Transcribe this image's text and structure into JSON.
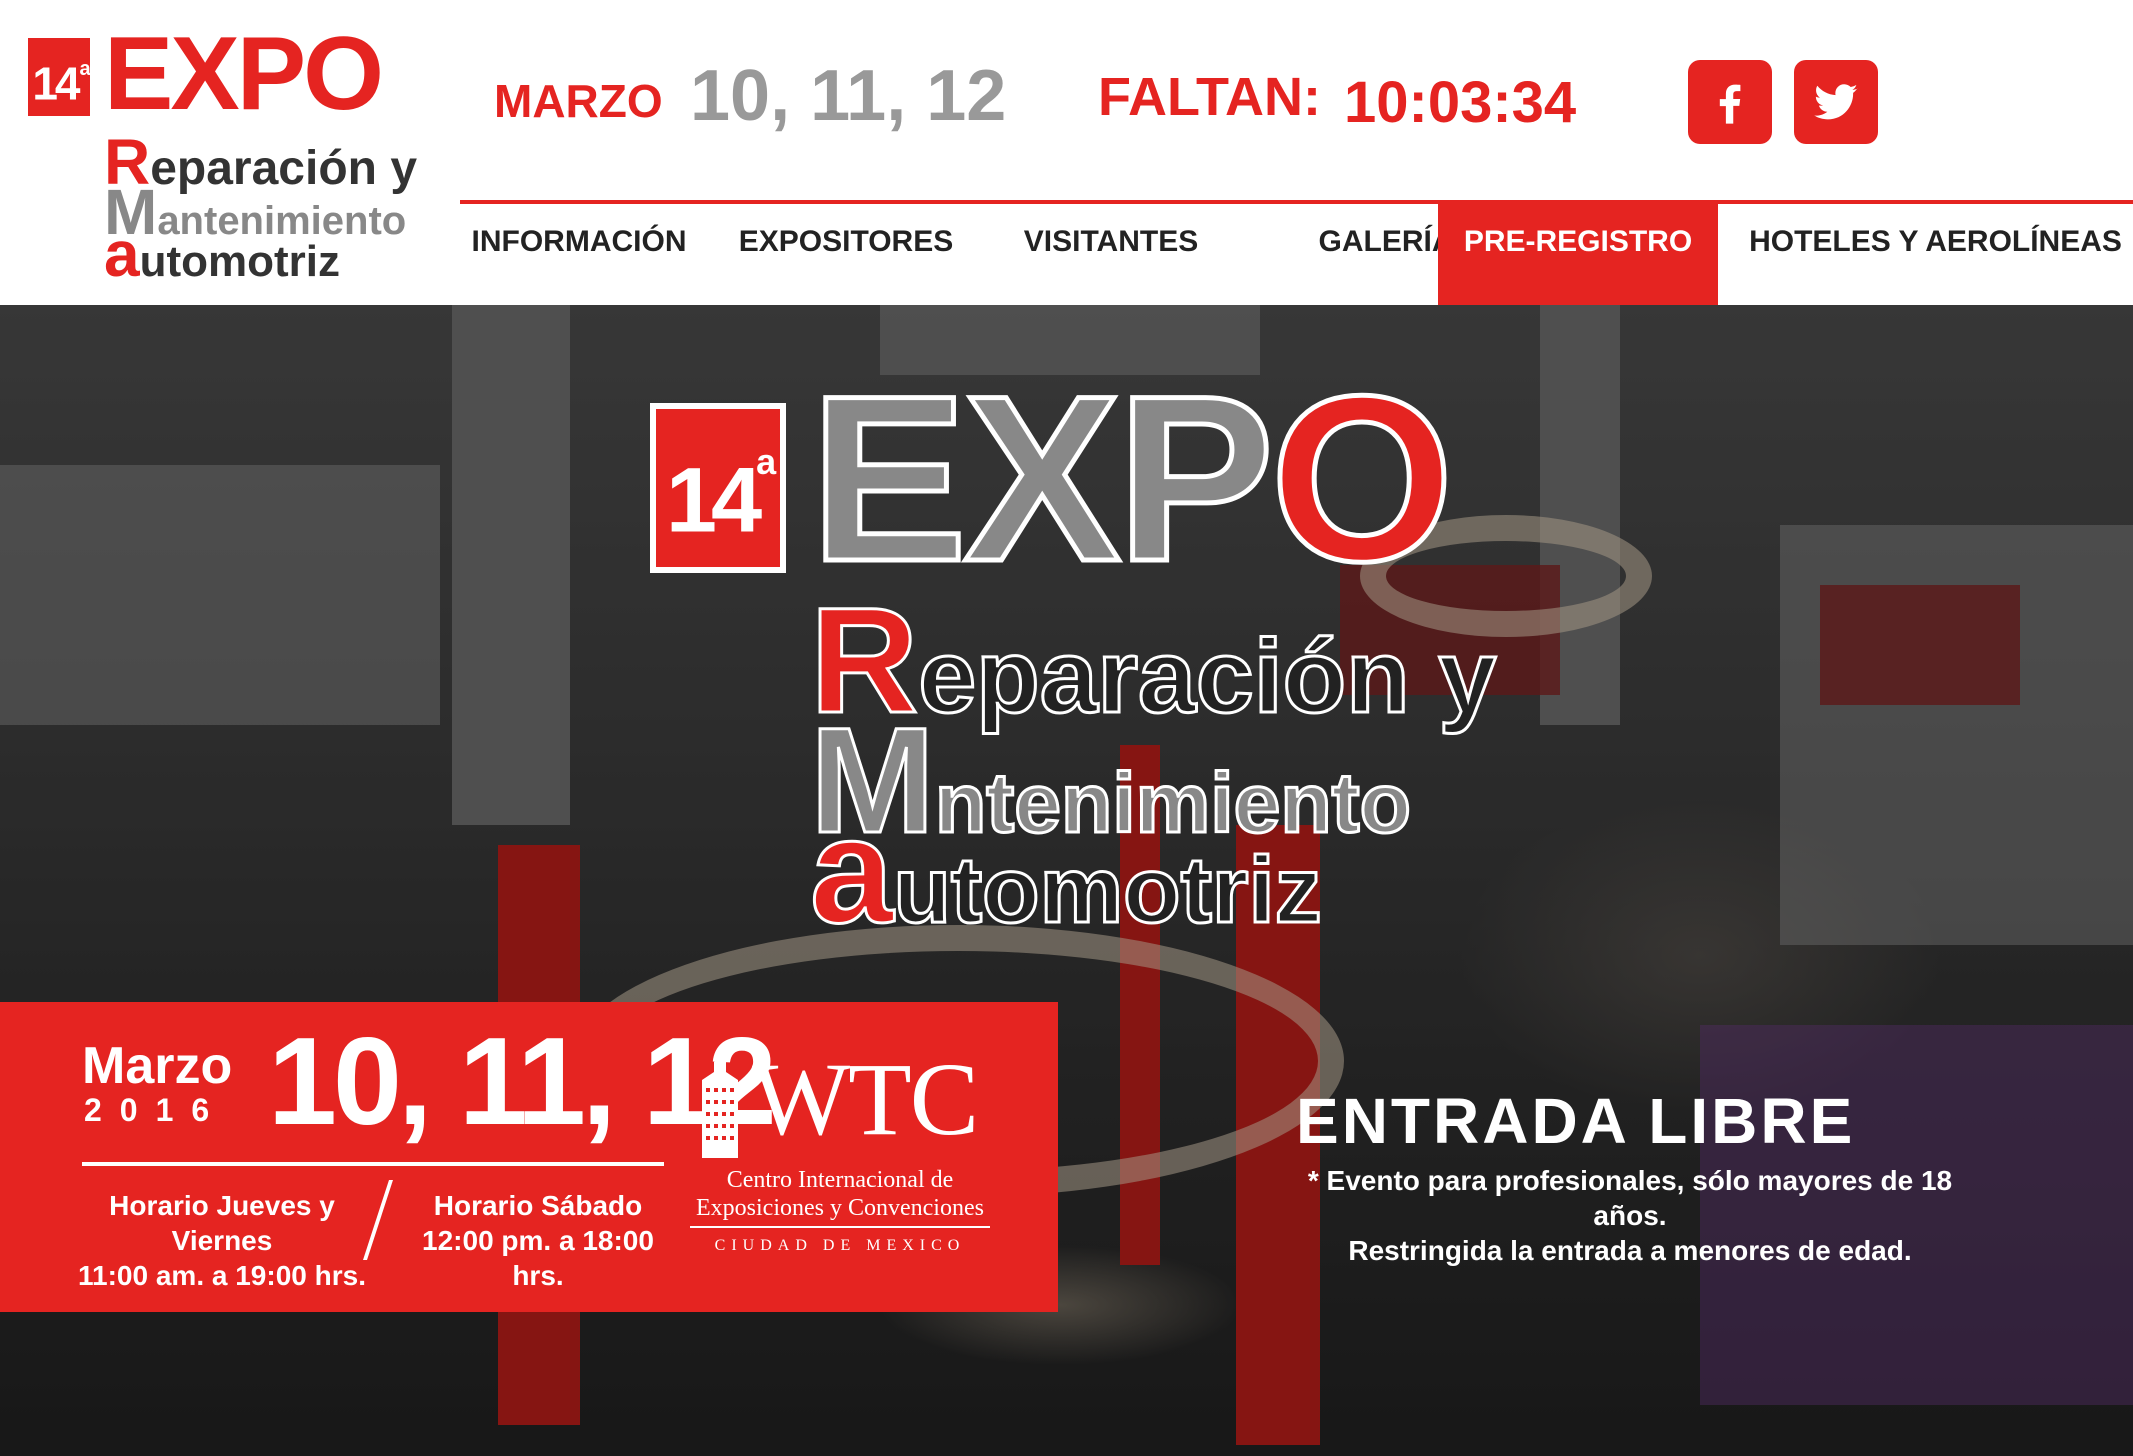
{
  "header": {
    "logo": {
      "badge": "14",
      "badge_sup": "a",
      "expo": "EXPO",
      "line1_initial": "R",
      "line1_rest": "eparación y",
      "line2_initial": "M",
      "line2_rest": "antenimiento",
      "line3_initial": "a",
      "line3_rest": "utomotriz"
    },
    "dates_label": "MARZO",
    "dates_value": "10, 11, 12",
    "countdown_label": "FALTAN:",
    "countdown_value": "10:03:34",
    "social": [
      {
        "name": "facebook-icon"
      },
      {
        "name": "twitter-icon"
      }
    ]
  },
  "nav": {
    "items": [
      {
        "label": "INFORMACIÓN"
      },
      {
        "label": "EXPOSITORES"
      },
      {
        "label": "VISITANTES"
      },
      {
        "label": "GALERÍA"
      },
      {
        "label": "PRE-REGISTRO",
        "active": true
      },
      {
        "label": "HOTELES Y AEROLÍNEAS"
      }
    ]
  },
  "hero": {
    "logo": {
      "badge": "14",
      "badge_sup": "a",
      "expo_e": "E",
      "expo_x": "X",
      "expo_p": "P",
      "expo_o": "O",
      "line1_initial": "R",
      "line1_rest": "eparación y",
      "line2_initial": "M",
      "line2_rest": "ntenimiento",
      "line3_initial": "a",
      "line3_rest": "utomotriz"
    },
    "event_box": {
      "month": "Marzo",
      "year": "2016",
      "days": "10, 11, 12",
      "schedule_weekdays_title": "Horario Jueves y Viernes",
      "schedule_weekdays_hours": "11:00 am. a 19:00 hrs.",
      "schedule_saturday_title": "Horario Sábado",
      "schedule_saturday_hours": "12:00 pm. a 18:00 hrs.",
      "venue": {
        "name": "WTC",
        "line1": "Centro Internacional de",
        "line2": "Exposiciones y Convenciones",
        "line3": "CIUDAD DE MEXICO"
      }
    },
    "entrada": "ENTRADA LIBRE",
    "note_line1": "* Evento para profesionales, sólo mayores de 18 años.",
    "note_line2": "Restringida la entrada a menores de edad."
  },
  "colors": {
    "accent": "#e52421",
    "gray": "#888888",
    "dark": "#222222"
  }
}
